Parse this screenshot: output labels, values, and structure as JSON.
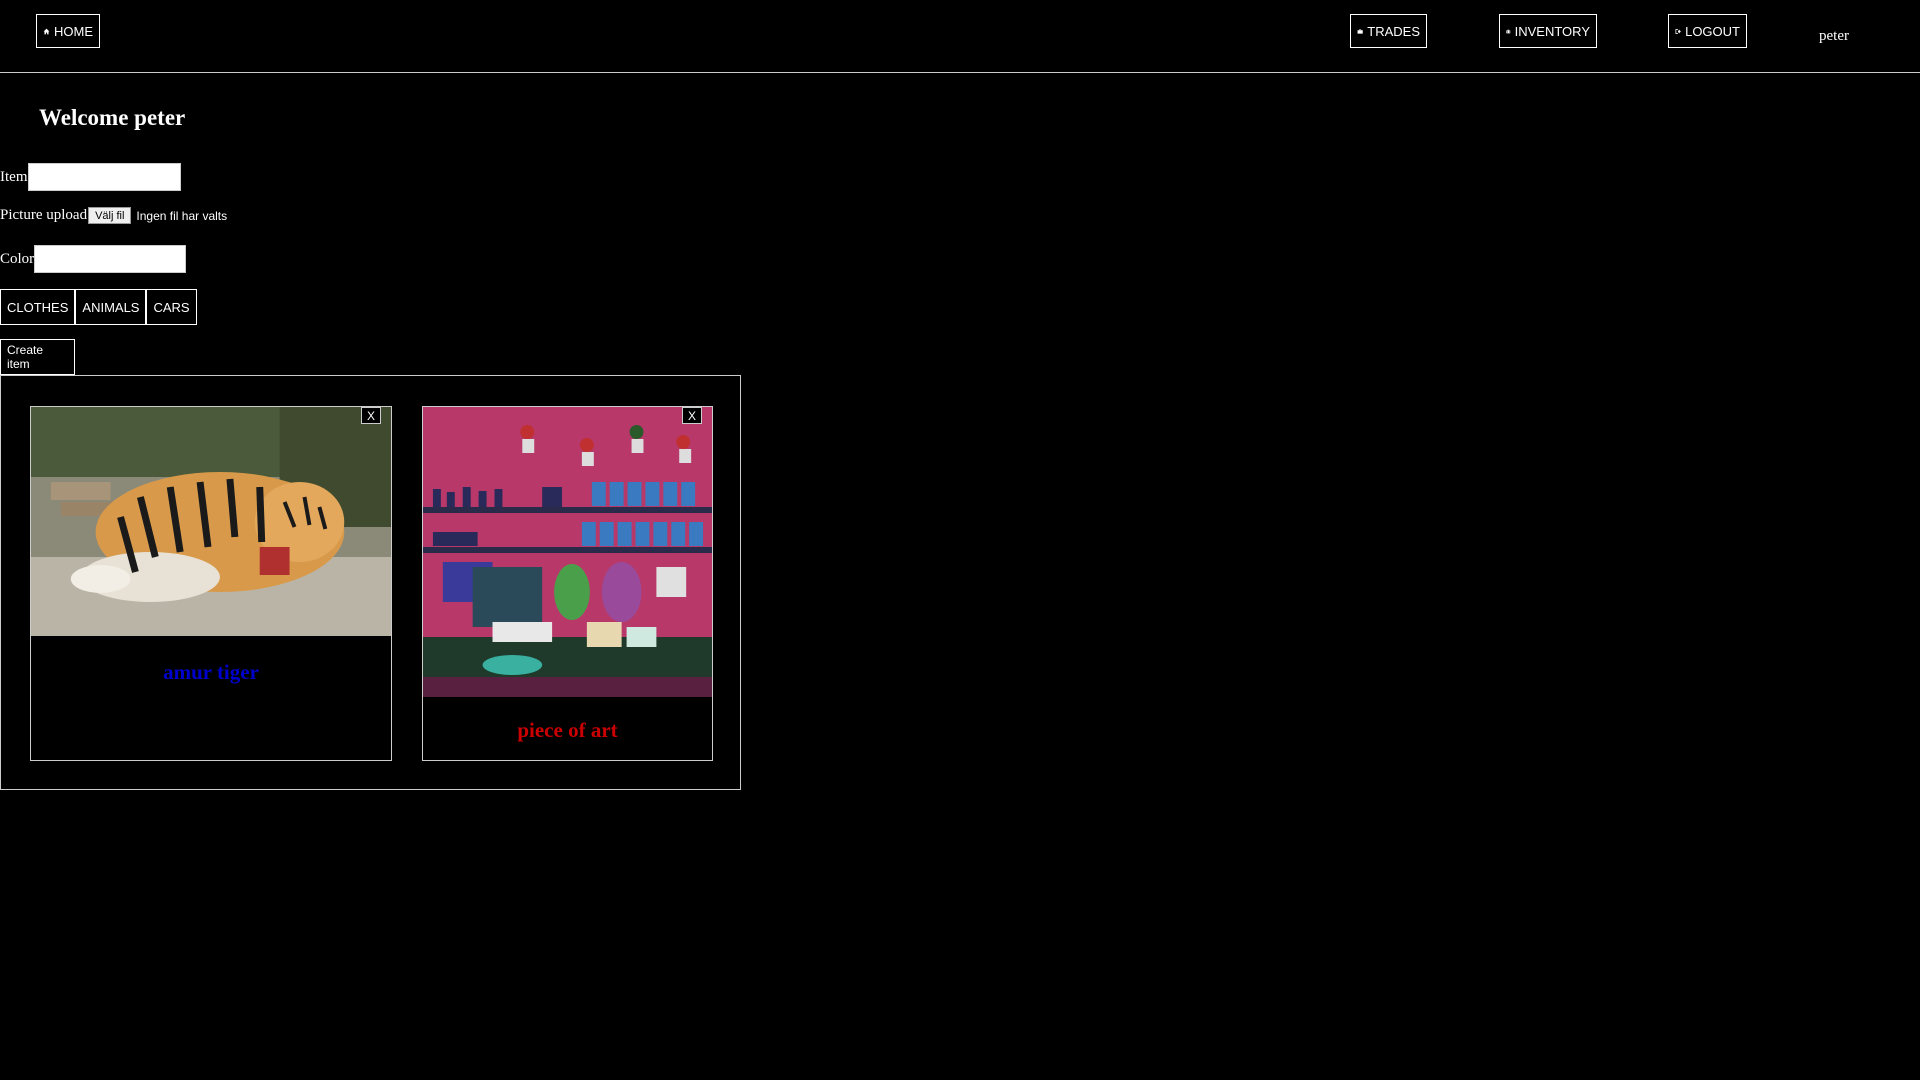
{
  "nav": {
    "home": "HOME",
    "trades": "TRADES",
    "inventory": "INVENTORY",
    "logout": "LOGOUT",
    "username": "peter",
    "icons": {
      "home": "home-icon",
      "trades": "briefcase-icon",
      "inventory": "suitcase-icon",
      "logout": "logout-icon"
    }
  },
  "welcome": "Welcome peter",
  "form": {
    "item_label": "Item",
    "item_value": "",
    "picture_label": "Picture upload",
    "file_button": "Välj fil",
    "file_status": "Ingen fil har valts",
    "color_label": "Color",
    "color_value": "",
    "categories": [
      "CLOTHES",
      "ANIMALS",
      "CARS"
    ],
    "create_button": "Create item"
  },
  "items": [
    {
      "title": "amur tiger",
      "title_color": "#0000cc",
      "image": "tiger-photo",
      "close": "X"
    },
    {
      "title": "piece of art",
      "title_color": "#cc0000",
      "image": "shop-illustration",
      "close": "X"
    }
  ]
}
